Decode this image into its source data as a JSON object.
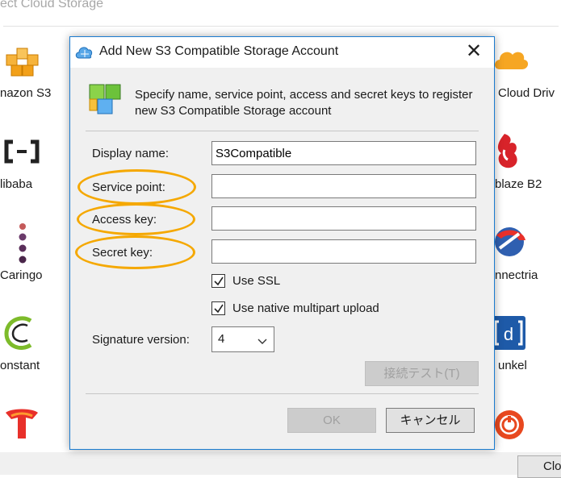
{
  "background": {
    "title": "ect Cloud Storage",
    "providers": [
      {
        "name": "amazon-s3",
        "label": "nazon S3",
        "icon": "amazon-s3-icon"
      },
      {
        "name": "alibaba",
        "label": "libaba",
        "icon": "alibaba-icon"
      },
      {
        "name": "caringo",
        "label": "Caringo",
        "icon": "caringo-icon"
      },
      {
        "name": "constant",
        "label": "onstant",
        "icon": "constant-icon"
      },
      {
        "name": "cloud-drive",
        "label": "Cloud Driv",
        "icon": "cloud-drive-icon"
      },
      {
        "name": "backblaze-b2",
        "label": "blaze B2",
        "icon": "backblaze-icon"
      },
      {
        "name": "connectria",
        "label": "nnectria",
        "icon": "connectria-icon"
      },
      {
        "name": "dunkel",
        "label": "unkel",
        "icon": "dunkel-icon"
      }
    ],
    "close_button": "Clo"
  },
  "dialog": {
    "title": "Add New S3 Compatible Storage Account",
    "close_glyph": "✕",
    "intro": "Specify name, service point, access and secret keys to register new S3 Compatible Storage account",
    "fields": {
      "display_name": {
        "label": "Display name:",
        "value": "S3Compatible"
      },
      "service_point": {
        "label": "Service point:",
        "value": ""
      },
      "access_key": {
        "label": "Access key:",
        "value": ""
      },
      "secret_key": {
        "label": "Secret key:",
        "value": ""
      }
    },
    "use_ssl": {
      "label": "Use SSL",
      "checked": true
    },
    "use_multipart": {
      "label": "Use native multipart upload",
      "checked": true
    },
    "signature": {
      "label": "Signature version:",
      "value": "4"
    },
    "test_button": "接続テスト(T)",
    "ok_button": "OK",
    "cancel_button": "キャンセル"
  },
  "colors": {
    "highlight_ellipse": "#f5a800",
    "dialog_border": "#1a7bd0"
  }
}
